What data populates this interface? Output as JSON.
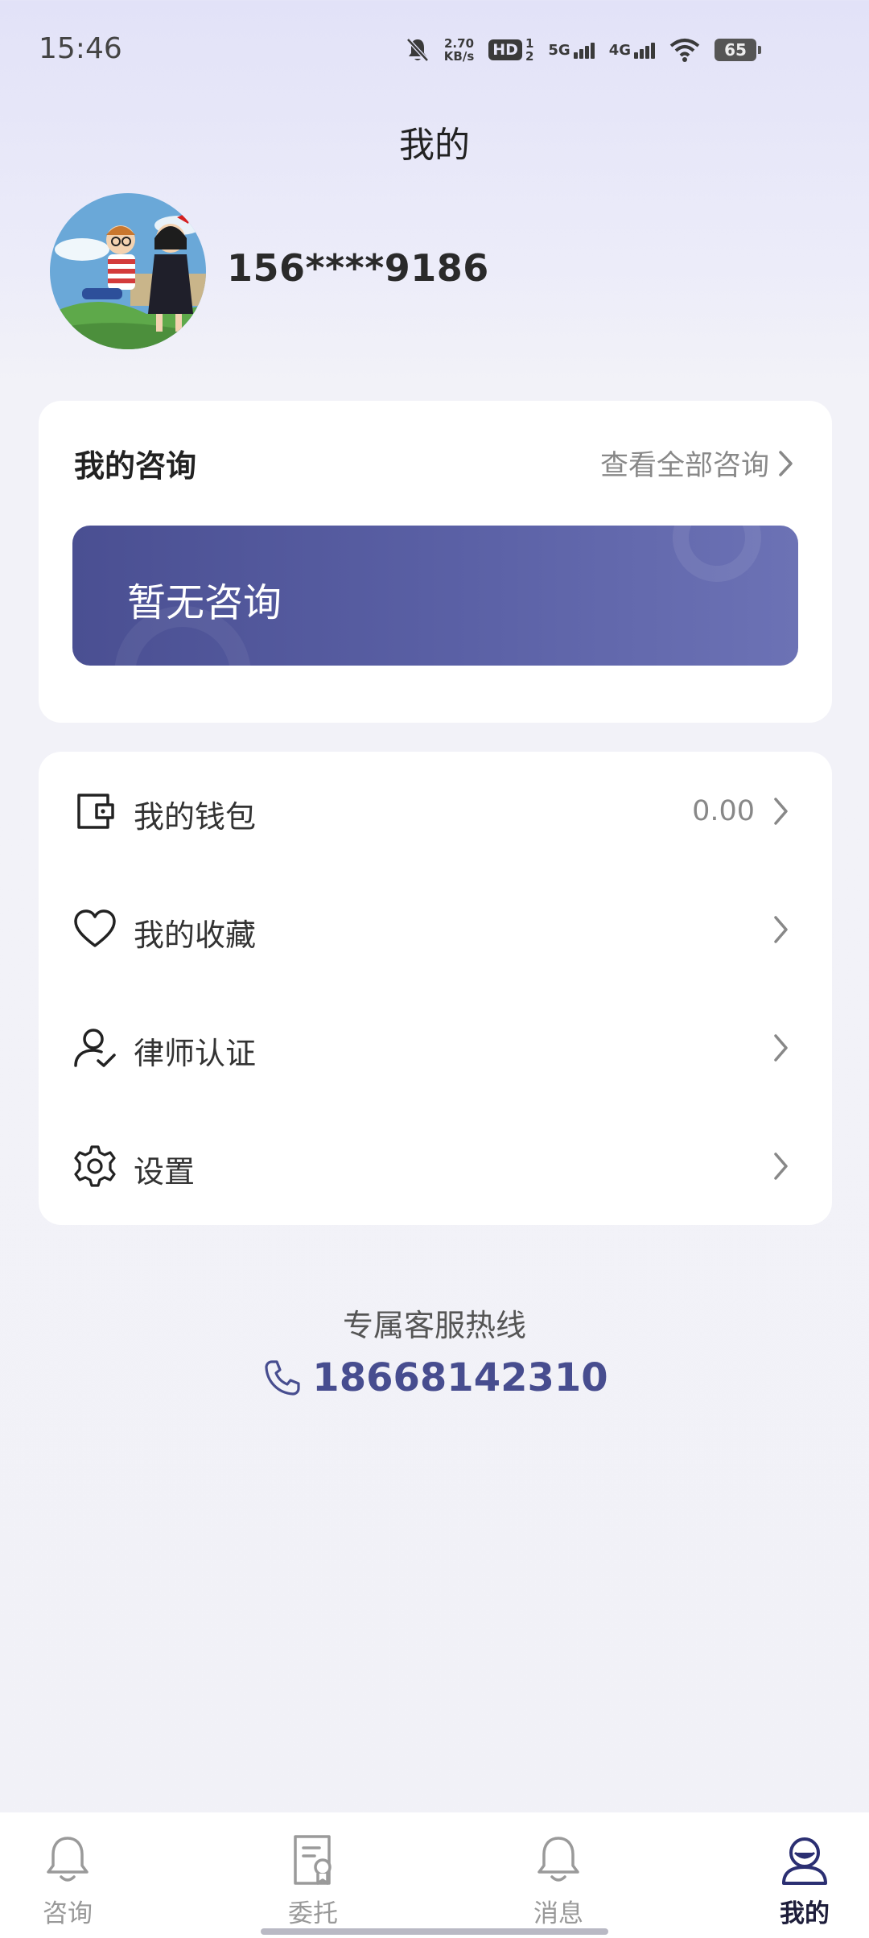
{
  "status_bar": {
    "time": "15:46",
    "net_speed_top": "2.70",
    "net_speed_bottom": "KB/s",
    "hd_label": "HD",
    "hd_sub_top": "1",
    "hd_sub_bottom": "2",
    "net1_label": "5G",
    "net2_label": "4G",
    "battery": "65",
    "icons": [
      "mute-bell-icon",
      "hd-icon",
      "signal-icon",
      "wifi-icon",
      "battery-icon"
    ]
  },
  "header": {
    "title": "我的"
  },
  "profile": {
    "username": "156****9186"
  },
  "consult": {
    "title": "我的咨询",
    "view_all": "查看全部咨询",
    "empty_text": "暂无咨询"
  },
  "menu": {
    "items": [
      {
        "label": "我的钱包",
        "value": "0.00",
        "icon": "wallet-icon"
      },
      {
        "label": "我的收藏",
        "value": "",
        "icon": "heart-icon"
      },
      {
        "label": "律师认证",
        "value": "",
        "icon": "user-check-icon"
      },
      {
        "label": "设置",
        "value": "",
        "icon": "gear-icon"
      }
    ]
  },
  "hotline": {
    "label": "专属客服热线",
    "number": "18668142310"
  },
  "tabbar": {
    "tabs": [
      {
        "label": "咨询",
        "icon": "bell-icon",
        "active": false
      },
      {
        "label": "委托",
        "icon": "document-badge-icon",
        "active": false
      },
      {
        "label": "消息",
        "icon": "bell-icon",
        "active": false
      },
      {
        "label": "我的",
        "icon": "person-icon",
        "active": true
      }
    ]
  },
  "colors": {
    "accent": "#474d8f",
    "banner_start": "#4a4f92",
    "banner_end": "#6c72b5",
    "background": "#f1f1f7"
  }
}
